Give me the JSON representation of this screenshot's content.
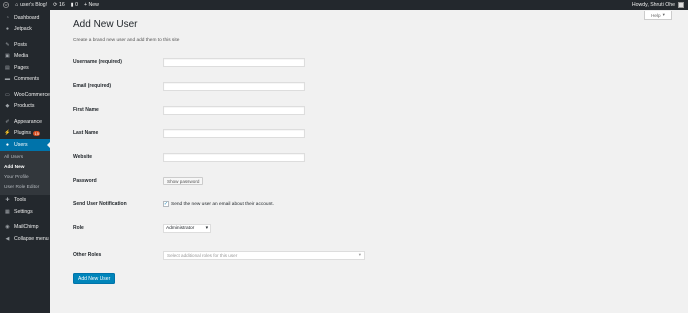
{
  "admin_bar": {
    "site_name": "user's Blog!",
    "updates_count": "16",
    "comments_count": "0",
    "new_label": "New",
    "greeting": "Howdy, Shruti Ohe"
  },
  "sidebar": {
    "items": [
      {
        "label": "Dashboard",
        "icon": "dashboard-icon"
      },
      {
        "label": "Jetpack",
        "icon": "jetpack-icon"
      },
      {
        "label": "Posts",
        "icon": "pin-icon"
      },
      {
        "label": "Media",
        "icon": "media-icon"
      },
      {
        "label": "Pages",
        "icon": "page-icon"
      },
      {
        "label": "Comments",
        "icon": "comment-icon"
      },
      {
        "label": "WooCommerce",
        "icon": "woocommerce-icon"
      },
      {
        "label": "Products",
        "icon": "products-icon"
      },
      {
        "label": "Appearance",
        "icon": "brush-icon"
      },
      {
        "label": "Plugins",
        "icon": "plugin-icon",
        "badge": "15"
      },
      {
        "label": "Users",
        "icon": "users-icon"
      },
      {
        "label": "Tools",
        "icon": "tools-icon"
      },
      {
        "label": "Settings",
        "icon": "settings-icon"
      },
      {
        "label": "MailChimp",
        "icon": "mailchimp-icon"
      },
      {
        "label": "Collapse menu",
        "icon": "collapse-icon"
      }
    ],
    "users_submenu": [
      "All Users",
      "Add New",
      "Your Profile",
      "User Role Editor"
    ]
  },
  "main": {
    "help_label": "Help",
    "title": "Add New User",
    "description": "Create a brand new user and add them to this site",
    "fields": {
      "username_label": "Username (required)",
      "email_label": "Email (required)",
      "first_name_label": "First Name",
      "last_name_label": "Last Name",
      "website_label": "Website",
      "password_label": "Password",
      "show_password_label": "Show password",
      "notification_label": "Send User Notification",
      "notification_text": "Send the new user an email about their account.",
      "notification_checked": true,
      "role_label": "Role",
      "role_value": "Administrator",
      "other_roles_label": "Other Roles",
      "other_roles_placeholder": "Select additional roles for this user"
    },
    "submit_label": "Add New User"
  },
  "colors": {
    "admin_dark": "#23282d",
    "accent": "#0073aa",
    "primary_button": "#0085ba",
    "background": "#f1f1f1"
  }
}
